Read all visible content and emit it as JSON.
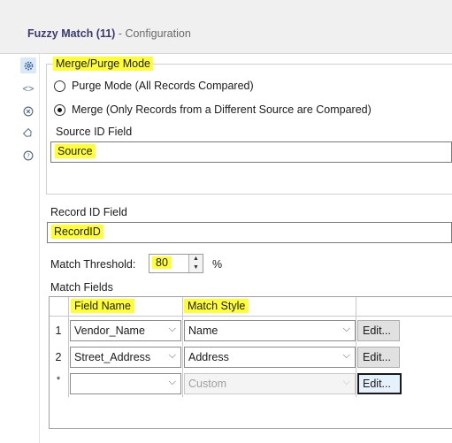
{
  "window": {
    "tool_name": "Fuzzy Match (11)",
    "separator": " - ",
    "panel": "Configuration"
  },
  "sidebar": {
    "icons": [
      {
        "name": "gear-icon",
        "glyph": "⚙"
      },
      {
        "name": "code-icon",
        "glyph": "<>"
      },
      {
        "name": "annotation-icon",
        "glyph": "⊗"
      },
      {
        "name": "tag-icon",
        "glyph": "◇"
      },
      {
        "name": "help-icon",
        "glyph": "?"
      }
    ]
  },
  "merge_purge": {
    "title": "Merge/Purge Mode",
    "option_purge": "Purge Mode (All Records Compared)",
    "option_merge": "Merge (Only Records from a Different Source are Compared)",
    "selected": "merge",
    "source_id_label": "Source ID Field",
    "source_id_value": "Source"
  },
  "record_id": {
    "label": "Record ID Field",
    "value": "RecordID"
  },
  "threshold": {
    "label": "Match Threshold:",
    "value": "80",
    "unit": "%"
  },
  "match_fields": {
    "label": "Match Fields",
    "col_field": "Field Name",
    "col_style": "Match Style",
    "rows": [
      {
        "num": "1",
        "field": "Vendor_Name",
        "style": "Name",
        "edit": "Edit..."
      },
      {
        "num": "2",
        "field": "Street_Address",
        "style": "Address",
        "edit": "Edit..."
      },
      {
        "num": "*",
        "field": "",
        "style": "Custom",
        "edit": "Edit..."
      }
    ]
  },
  "colors": {
    "highlight": "#ffff33",
    "title_text": "#3b3b6e"
  }
}
